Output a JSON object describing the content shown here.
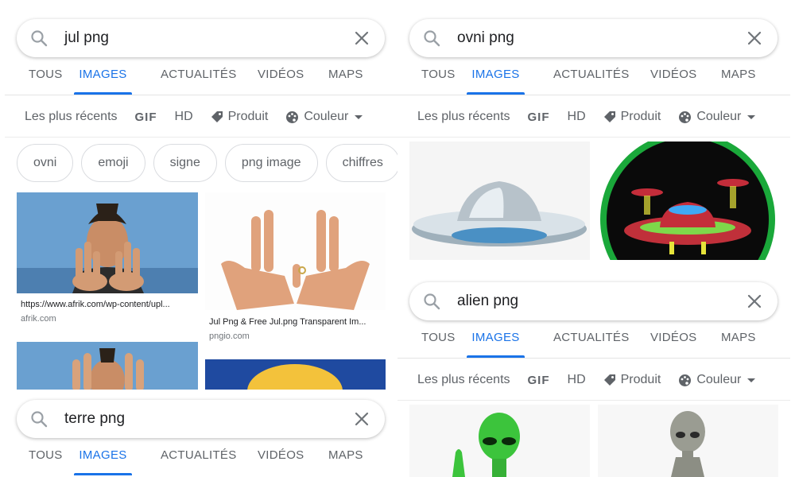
{
  "left_panel": {
    "search": {
      "query": "jul png",
      "clear_icon": "close-icon",
      "search_icon": "search-icon"
    },
    "tabs": [
      {
        "label": "TOUS",
        "active": false
      },
      {
        "label": "IMAGES",
        "active": true
      },
      {
        "label": "ACTUALITÉS",
        "active": false
      },
      {
        "label": "VIDÉOS",
        "active": false
      },
      {
        "label": "MAPS",
        "active": false
      }
    ],
    "filters": {
      "recent": "Les plus récents",
      "gif": "GIF",
      "hd": "HD",
      "product": "Produit",
      "color": "Couleur"
    },
    "chips": [
      "ovni",
      "emoji",
      "signe",
      "png image",
      "chiffres"
    ],
    "results": [
      {
        "caption": "https://www.afrik.com/wp-content/upl...",
        "domain": "afrik.com"
      },
      {
        "caption": "Jul Png & Free Jul.png Transparent Im...",
        "domain": "pngio.com"
      }
    ],
    "second_search": {
      "query": "terre png",
      "tabs": [
        {
          "label": "TOUS",
          "active": false
        },
        {
          "label": "IMAGES",
          "active": true
        },
        {
          "label": "ACTUALITÉS",
          "active": false
        },
        {
          "label": "VIDÉOS",
          "active": false
        },
        {
          "label": "MAPS",
          "active": false
        }
      ]
    }
  },
  "right_panel": {
    "search": {
      "query": "ovni png"
    },
    "tabs": [
      {
        "label": "TOUS",
        "active": false
      },
      {
        "label": "IMAGES",
        "active": true
      },
      {
        "label": "ACTUALITÉS",
        "active": false
      },
      {
        "label": "VIDÉOS",
        "active": false
      },
      {
        "label": "MAPS",
        "active": false
      }
    ],
    "filters": {
      "recent": "Les plus récents",
      "gif": "GIF",
      "hd": "HD",
      "product": "Produit",
      "color": "Couleur"
    },
    "second_search": {
      "query": "alien png",
      "tabs": [
        {
          "label": "TOUS",
          "active": false
        },
        {
          "label": "IMAGES",
          "active": true
        },
        {
          "label": "ACTUALITÉS",
          "active": false
        },
        {
          "label": "VIDÉOS",
          "active": false
        },
        {
          "label": "MAPS",
          "active": false
        }
      ],
      "filters": {
        "recent": "Les plus récents",
        "gif": "GIF",
        "hd": "HD",
        "product": "Produit",
        "color": "Couleur"
      }
    }
  },
  "colors": {
    "accent": "#1a73e8",
    "text": "#5f6368",
    "border": "#dadce0"
  }
}
